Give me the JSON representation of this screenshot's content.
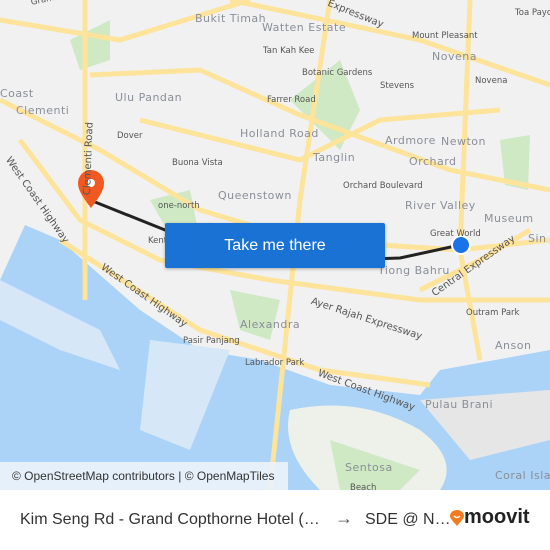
{
  "map": {
    "labels": [
      {
        "text": "Grand Expressway",
        "cls": "small"
      },
      {
        "text": "Bukit Timah",
        "cls": "big"
      },
      {
        "text": "Watten Estate",
        "cls": "big"
      },
      {
        "text": "Expressway",
        "cls": ""
      },
      {
        "text": "Toa Payoh",
        "cls": "small"
      },
      {
        "text": "Mount Pleasant",
        "cls": "small"
      },
      {
        "text": "Tan Kah Kee",
        "cls": "small"
      },
      {
        "text": "Novena",
        "cls": "big"
      },
      {
        "text": "Botanic Gardens",
        "cls": "small"
      },
      {
        "text": "Stevens",
        "cls": "small"
      },
      {
        "text": "Novena",
        "cls": "small"
      },
      {
        "text": "Coast",
        "cls": "big"
      },
      {
        "text": "Ulu Pandan",
        "cls": "big"
      },
      {
        "text": "Farrer Road",
        "cls": "small"
      },
      {
        "text": "Clementi",
        "cls": "big"
      },
      {
        "text": "Dover",
        "cls": "small"
      },
      {
        "text": "Holland Road",
        "cls": "big"
      },
      {
        "text": "Ardmore",
        "cls": "big"
      },
      {
        "text": "Newton",
        "cls": "big"
      },
      {
        "text": "Tanglin",
        "cls": "big"
      },
      {
        "text": "Buona Vista",
        "cls": "small"
      },
      {
        "text": "Orchard",
        "cls": "big"
      },
      {
        "text": "Orchard Boulevard",
        "cls": "small"
      },
      {
        "text": "Queenstown",
        "cls": "big"
      },
      {
        "text": "one-north",
        "cls": "small"
      },
      {
        "text": "River Valley",
        "cls": "big"
      },
      {
        "text": "Museum",
        "cls": "big"
      },
      {
        "text": "Great World",
        "cls": "small"
      },
      {
        "text": "Sin",
        "cls": "big"
      },
      {
        "text": "Kent",
        "cls": "small"
      },
      {
        "text": "Tiong Bahru",
        "cls": "big"
      },
      {
        "text": "Ayer Rajah Expressway",
        "cls": ""
      },
      {
        "text": "Central Expressway",
        "cls": ""
      },
      {
        "text": "Outram Park",
        "cls": "small"
      },
      {
        "text": "Alexandra",
        "cls": "big"
      },
      {
        "text": "Pasir Panjang",
        "cls": "small"
      },
      {
        "text": "Anson",
        "cls": "big"
      },
      {
        "text": "Labrador Park",
        "cls": "small"
      },
      {
        "text": "West Coast Highway",
        "cls": ""
      },
      {
        "text": "Pulau Brani",
        "cls": "big"
      },
      {
        "text": "Sentosa",
        "cls": "big"
      },
      {
        "text": "Beach",
        "cls": "small"
      },
      {
        "text": "Coral Island",
        "cls": "big"
      },
      {
        "text": "West Coast Highway",
        "cls": ""
      },
      {
        "text": "West Coast Highway",
        "cls": ""
      },
      {
        "text": "Clementi Road",
        "cls": ""
      }
    ],
    "cta_label": "Take me there",
    "attribution": "© OpenStreetMap contributors | © OpenMapTiles",
    "colors": {
      "route": "#222222",
      "origin": "#1a73e8",
      "destination": "#f05a22",
      "button": "#1a73d4",
      "water": "#aad3f7",
      "park": "#cfe9c4",
      "road": "#fde9a0"
    }
  },
  "footer": {
    "from": "Kim Seng Rd - Grand Copthorne Hotel (…",
    "arrow_icon": "arrow-right-icon",
    "to": "SDE @ N…",
    "brand": "moovit"
  }
}
